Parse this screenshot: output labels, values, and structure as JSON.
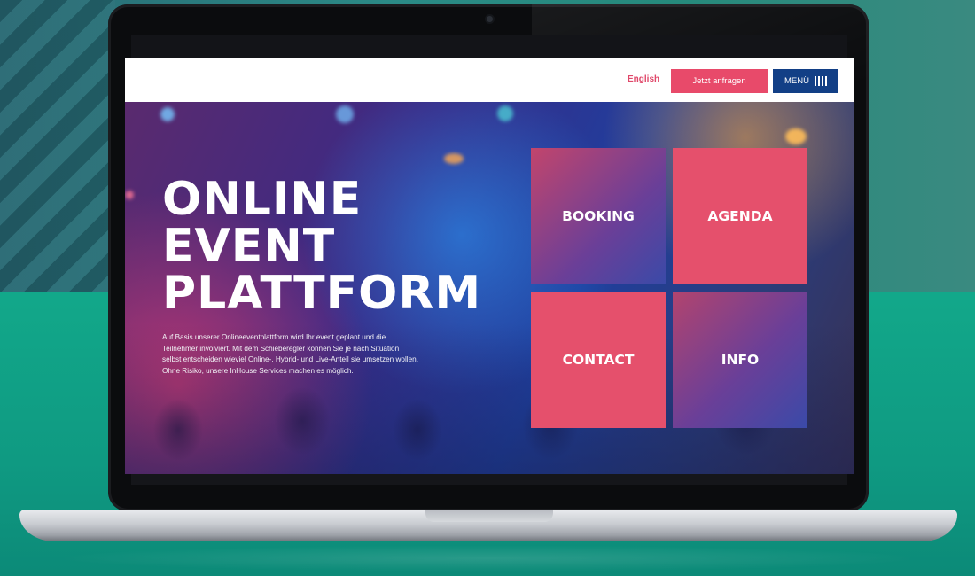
{
  "header": {
    "language_link": "English",
    "request_button": "Jetzt anfragen",
    "menu_button": "MENÜ"
  },
  "hero": {
    "title_lines": [
      "ONLINE",
      "EVENT",
      "PLATTFORM"
    ],
    "description": "Auf Basis unserer Onlineeventplattform wird Ihr event geplant und die Teilnehmer involviert. Mit dem Schieberegler können Sie je nach Situation selbst entscheiden wieviel Online-, Hybrid- und Live-Anteil sie umsetzen wollen. Ohne Risiko, unsere InHouse Services machen es möglich."
  },
  "tiles": {
    "booking": "BOOKING",
    "agenda": "AGENDA",
    "contact": "CONTACT",
    "info": "INFO"
  },
  "colors": {
    "accent_pink": "#e84a6a",
    "menu_blue": "#123f86",
    "background_teal": "#12a88a"
  },
  "icons": {
    "menu": "menu-bars-icon",
    "camera": "camera-icon"
  }
}
